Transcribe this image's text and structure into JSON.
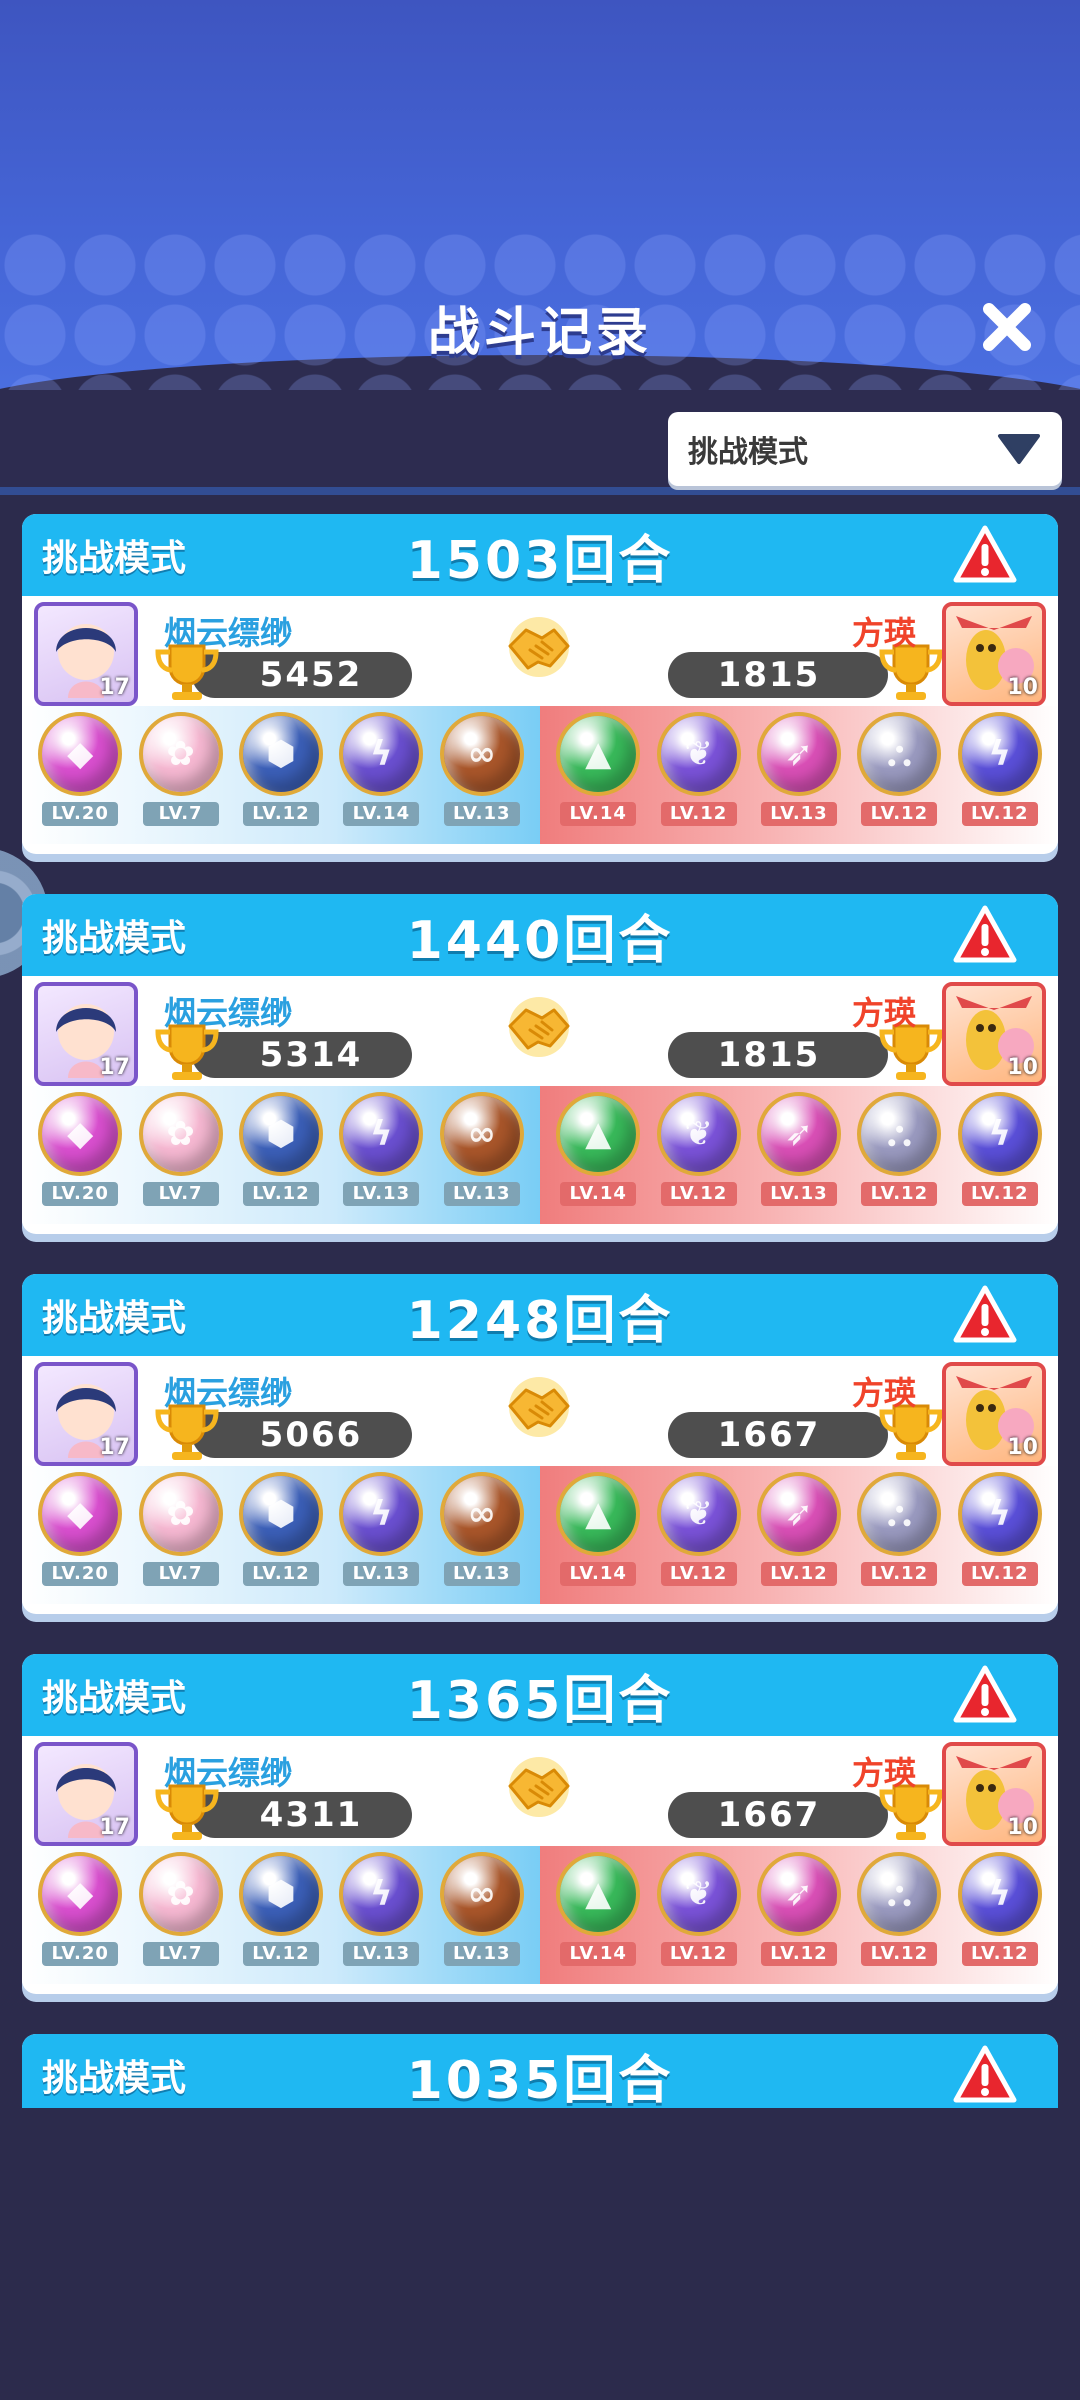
{
  "header": {
    "title": "战斗记录"
  },
  "filter": {
    "selected": "挑战模式"
  },
  "records": [
    {
      "mode": "挑战模式",
      "rounds": "1503回合",
      "player": {
        "name": "烟云缥缈",
        "score": "5452",
        "level": "17"
      },
      "opponent": {
        "name": "方瑛",
        "score": "1815",
        "level": "10"
      },
      "player_pets": [
        "LV.20",
        "LV.7",
        "LV.12",
        "LV.14",
        "LV.13"
      ],
      "opponent_pets": [
        "LV.14",
        "LV.12",
        "LV.13",
        "LV.12",
        "LV.12"
      ]
    },
    {
      "mode": "挑战模式",
      "rounds": "1440回合",
      "player": {
        "name": "烟云缥缈",
        "score": "5314",
        "level": "17"
      },
      "opponent": {
        "name": "方瑛",
        "score": "1815",
        "level": "10"
      },
      "player_pets": [
        "LV.20",
        "LV.7",
        "LV.12",
        "LV.13",
        "LV.13"
      ],
      "opponent_pets": [
        "LV.14",
        "LV.12",
        "LV.13",
        "LV.12",
        "LV.12"
      ]
    },
    {
      "mode": "挑战模式",
      "rounds": "1248回合",
      "player": {
        "name": "烟云缥缈",
        "score": "5066",
        "level": "17"
      },
      "opponent": {
        "name": "方瑛",
        "score": "1667",
        "level": "10"
      },
      "player_pets": [
        "LV.20",
        "LV.7",
        "LV.12",
        "LV.13",
        "LV.13"
      ],
      "opponent_pets": [
        "LV.14",
        "LV.12",
        "LV.12",
        "LV.12",
        "LV.12"
      ]
    },
    {
      "mode": "挑战模式",
      "rounds": "1365回合",
      "player": {
        "name": "烟云缥缈",
        "score": "4311",
        "level": "17"
      },
      "opponent": {
        "name": "方瑛",
        "score": "1667",
        "level": "10"
      },
      "player_pets": [
        "LV.20",
        "LV.7",
        "LV.12",
        "LV.13",
        "LV.13"
      ],
      "opponent_pets": [
        "LV.14",
        "LV.12",
        "LV.12",
        "LV.12",
        "LV.12"
      ]
    },
    {
      "mode": "挑战模式",
      "rounds": "1035回合"
    }
  ],
  "colors": {
    "card_header": "#1fb8f2",
    "player_name": "#2aa0e0",
    "opponent_name": "#f0432a",
    "warning": "#e8262e"
  },
  "icons": {
    "close": "close-icon",
    "dropdown": "triangle-down-icon",
    "warning": "warning-icon",
    "trophy": "trophy-icon",
    "handshake": "handshake-icon"
  }
}
